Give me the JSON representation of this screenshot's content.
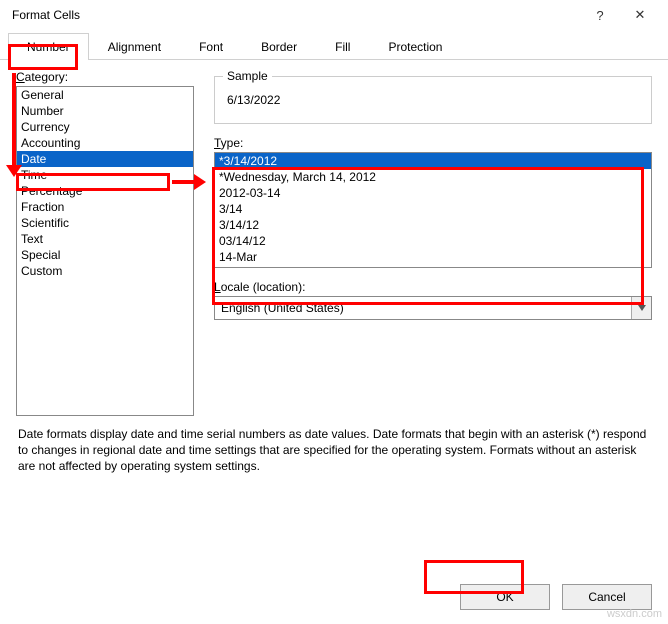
{
  "titlebar": {
    "title": "Format Cells",
    "help_symbol": "?",
    "close_symbol": "✕"
  },
  "tabs": [
    {
      "label": "Number",
      "active": true
    },
    {
      "label": "Alignment",
      "active": false
    },
    {
      "label": "Font",
      "active": false
    },
    {
      "label": "Border",
      "active": false
    },
    {
      "label": "Fill",
      "active": false
    },
    {
      "label": "Protection",
      "active": false
    }
  ],
  "category_label": "Category:",
  "categories": [
    {
      "label": "General",
      "selected": false
    },
    {
      "label": "Number",
      "selected": false
    },
    {
      "label": "Currency",
      "selected": false
    },
    {
      "label": "Accounting",
      "selected": false
    },
    {
      "label": "Date",
      "selected": true
    },
    {
      "label": "Time",
      "selected": false
    },
    {
      "label": "Percentage",
      "selected": false
    },
    {
      "label": "Fraction",
      "selected": false
    },
    {
      "label": "Scientific",
      "selected": false
    },
    {
      "label": "Text",
      "selected": false
    },
    {
      "label": "Special",
      "selected": false
    },
    {
      "label": "Custom",
      "selected": false
    }
  ],
  "sample": {
    "legend": "Sample",
    "value": "6/13/2022"
  },
  "type_label": "Type:",
  "types": [
    {
      "label": "*3/14/2012",
      "selected": true
    },
    {
      "label": "*Wednesday, March 14, 2012",
      "selected": false
    },
    {
      "label": "2012-03-14",
      "selected": false
    },
    {
      "label": "3/14",
      "selected": false
    },
    {
      "label": "3/14/12",
      "selected": false
    },
    {
      "label": "03/14/12",
      "selected": false
    },
    {
      "label": "14-Mar",
      "selected": false
    }
  ],
  "locale_label": "Locale (location):",
  "locale_value": "English (United States)",
  "description": "Date formats display date and time serial numbers as date values.  Date formats that begin with an asterisk (*) respond to changes in regional date and time settings that are specified for the operating system.  Formats without an asterisk are not affected by operating system settings.",
  "buttons": {
    "ok": "OK",
    "cancel": "Cancel"
  },
  "watermark": "wsxdn.com"
}
